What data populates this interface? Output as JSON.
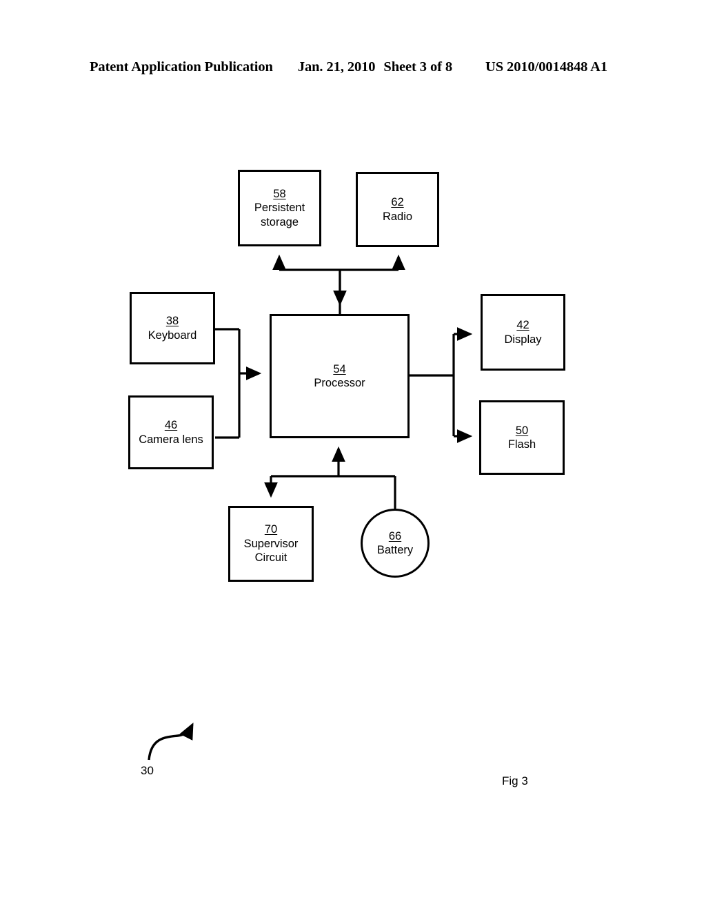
{
  "header": {
    "publication": "Patent Application Publication",
    "date": "Jan. 21, 2010",
    "sheet": "Sheet 3 of 8",
    "patent_number": "US 2010/0014848 A1"
  },
  "figure": {
    "caption": "Fig 3",
    "system_reference": "30",
    "nodes": {
      "persistent_storage": {
        "ref": "58",
        "label": "Persistent\nstorage"
      },
      "radio": {
        "ref": "62",
        "label": "Radio"
      },
      "keyboard": {
        "ref": "38",
        "label": "Keyboard"
      },
      "camera_lens": {
        "ref": "46",
        "label": "Camera lens"
      },
      "processor": {
        "ref": "54",
        "label": "Processor"
      },
      "display": {
        "ref": "42",
        "label": "Display"
      },
      "flash": {
        "ref": "50",
        "label": "Flash"
      },
      "supervisor_circuit": {
        "ref": "70",
        "label": "Supervisor\nCircuit"
      },
      "battery": {
        "ref": "66",
        "label": "Battery"
      }
    },
    "connections": [
      {
        "from": "processor",
        "to": "persistent_storage",
        "direction": "to"
      },
      {
        "from": "processor",
        "to": "radio",
        "direction": "to"
      },
      {
        "from": "keyboard",
        "to": "processor",
        "direction": "to"
      },
      {
        "from": "camera_lens",
        "to": "processor",
        "direction": "to"
      },
      {
        "from": "processor",
        "to": "display",
        "direction": "to"
      },
      {
        "from": "processor",
        "to": "flash",
        "direction": "to"
      },
      {
        "from": "battery",
        "to": "processor",
        "direction": "to"
      },
      {
        "from": "battery",
        "to": "supervisor_circuit",
        "direction": "to"
      }
    ]
  },
  "colors": {
    "ink": "#000000",
    "paper": "#ffffff"
  }
}
